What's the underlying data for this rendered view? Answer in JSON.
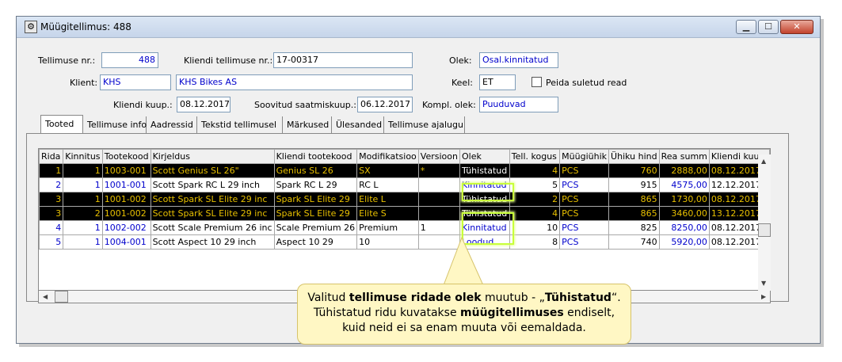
{
  "window": {
    "title": "Müügitellimus: 488",
    "buttons": {
      "minimize": "▁",
      "maximize": "☐",
      "close": "✕"
    }
  },
  "header": {
    "order_no_label": "Tellimuse nr.:",
    "order_no": "488",
    "client_order_label": "Kliendi tellimuse nr.:",
    "client_order": "17-00317",
    "status_label": "Olek:",
    "status": "Osal.kinnitatud",
    "client_label": "Klient:",
    "client_code": "KHS",
    "client_name": "KHS Bikes AS",
    "lang_label": "Keel:",
    "lang": "ET",
    "hide_closed_label": "Peida suletud read",
    "client_date_label": "Kliendi kuup.:",
    "client_date": "08.12.2017",
    "delivery_label": "Soovitud saatmiskuup.:",
    "delivery_date": "06.12.2017",
    "compl_label": "Kompl. olek:",
    "compl_status": "Puuduvad"
  },
  "tabs": [
    "Tooted",
    "Tellimuse info",
    "Aadressid",
    "Tekstid tellimusel",
    "Märkused",
    "Ülesanded",
    "Tellimuse ajalugu"
  ],
  "table": {
    "headers": [
      "Rida",
      "Kinnitus",
      "Tootekood",
      "Kirjeldus",
      "Kliendi tootekood",
      "Modifikatsioo",
      "Versioon",
      "Olek",
      "Tell. kogus",
      "Müügiühik",
      "Ühiku hind",
      "Rea summ",
      "Kliendi kuup."
    ],
    "rows": [
      {
        "style": "black",
        "cells": [
          "1",
          "1",
          "1003-001",
          "Scott Genius SL 26\"",
          "Genius SL 26",
          "SX",
          "*",
          "Tühistatud",
          "4",
          "PCS",
          "760",
          "2888,00",
          "08.12.2017"
        ]
      },
      {
        "style": "white",
        "cells": [
          "2",
          "1",
          "1001-001",
          "Scott Spark RC L 29 inch",
          "Spark RC L 29",
          "RC L",
          "",
          "Kinnitatud",
          "5",
          "PCS",
          "915",
          "4575,00",
          "12.12.2017"
        ]
      },
      {
        "style": "black",
        "cells": [
          "3",
          "1",
          "1001-002",
          "Scott Spark SL Elite 29 inc",
          "Spark SL Elite 29",
          "Elite L",
          "",
          "Tühistatud",
          "2",
          "PCS",
          "865",
          "1730,00",
          "08.12.2017"
        ]
      },
      {
        "style": "black",
        "cells": [
          "3",
          "2",
          "1001-002",
          "Scott Spark SL Elite 29 inc",
          "Spark SL Elite 29",
          "Elite S",
          "",
          "Tühistatud",
          "4",
          "PCS",
          "865",
          "3460,00",
          "13.12.2017"
        ]
      },
      {
        "style": "white",
        "cells": [
          "4",
          "1",
          "1002-002",
          "Scott Scale Premium 26 inc",
          "Scale Premium 26",
          "Premium",
          "1",
          "Kinnitatud",
          "10",
          "PCS",
          "825",
          "8250,00",
          "08.12.2017"
        ]
      },
      {
        "style": "white",
        "cells": [
          "5",
          "1",
          "1004-001",
          "Scott Aspect 10 29 inch",
          "Aspect 10 29",
          "10",
          "",
          "Loodud",
          "8",
          "PCS",
          "740",
          "5920,00",
          "08.12.2017"
        ]
      }
    ]
  },
  "callout": {
    "line1_pre": "Valitud ",
    "line1_bold": "tellimuse ridade olek",
    "line1_post": " muutub - „",
    "line1_bold2": "Tühistatud",
    "line1_end": "“.",
    "line2_pre": "Tühistatud ridu kuvatakse ",
    "line2_bold": "müügitellimuses",
    "line2_post": " endiselt,",
    "line3": "kuid neid ei sa enam muuta või eemaldada."
  },
  "colors": {
    "highlight": "#c8ff3a",
    "callout_bg": "#fff7c4",
    "link_blue": "#0000cc"
  }
}
